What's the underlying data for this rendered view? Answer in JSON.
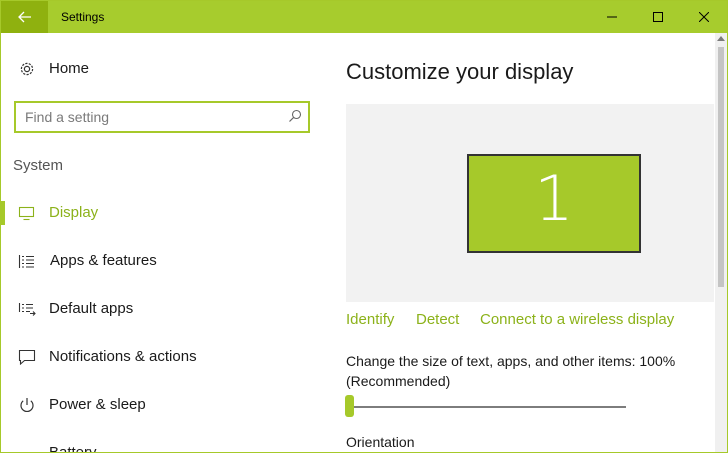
{
  "colors": {
    "accent": "#a6c92a",
    "titlebar": "#a7cc2d",
    "back_button": "#8fb10f",
    "link": "#8cb21a"
  },
  "window": {
    "title": "Settings",
    "controls": [
      "back-arrow-icon",
      "minimize-icon",
      "maximize-icon",
      "close-icon"
    ]
  },
  "sidebar": {
    "home_label": "Home",
    "search_placeholder": "Find a setting",
    "section_heading": "System",
    "items": [
      {
        "label": "Display",
        "icon": "monitor-icon",
        "active": true
      },
      {
        "label": "Apps & features",
        "icon": "list-icon",
        "active": false
      },
      {
        "label": "Default apps",
        "icon": "default-apps-icon",
        "active": false
      },
      {
        "label": "Notifications & actions",
        "icon": "notification-icon",
        "active": false
      },
      {
        "label": "Power & sleep",
        "icon": "power-icon",
        "active": false
      },
      {
        "label": "Battery",
        "icon": "battery-icon",
        "active": false
      }
    ]
  },
  "main": {
    "title": "Customize your display",
    "monitor_number": "1",
    "links": {
      "identify": "Identify",
      "detect": "Detect",
      "wireless": "Connect to a wireless display"
    },
    "scale_label": "Change the size of text, apps, and other items: 100% (Recommended)",
    "scale_slider_fraction": 0.0,
    "orientation_label": "Orientation"
  }
}
